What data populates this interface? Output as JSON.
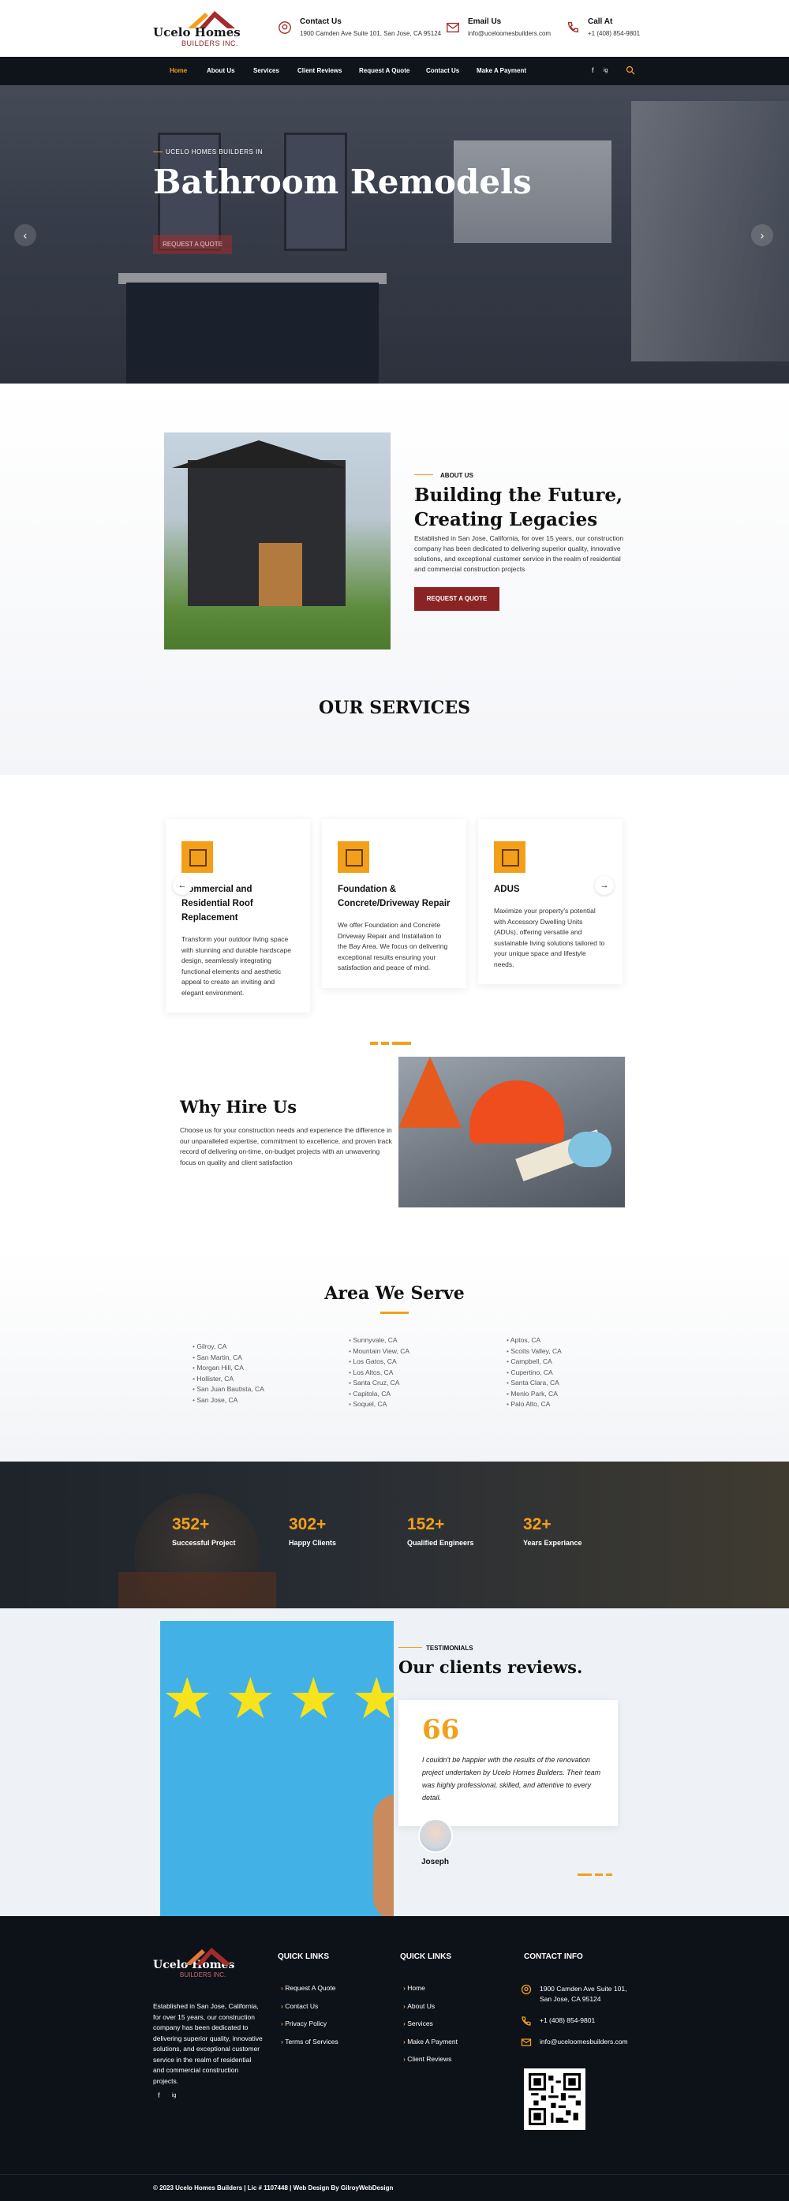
{
  "header": {
    "logo_name": "Ucelo Homes",
    "logo_sub": "BUILDERS INC.",
    "contact_us_title": "Contact Us",
    "contact_us_value": "1900 Camden Ave Suite 101, San Jose, CA 95124",
    "email_title": "Email Us",
    "email_value": "info@uceloomesbuilders.com",
    "call_title": "Call At",
    "call_value": "+1 (408) 854-9801"
  },
  "nav": {
    "items": [
      "Home",
      "About Us",
      "Services",
      "Client Reviews",
      "Request A Quote",
      "Contact Us",
      "Make A Payment"
    ],
    "social": [
      "f",
      "ig"
    ],
    "search_icon": "search-icon"
  },
  "hero": {
    "eyebrow": "UCELO HOMES BUILDERS IN",
    "title": "Bathroom Remodels",
    "cta": "REQUEST A QUOTE",
    "prev": "‹",
    "next": "›"
  },
  "about": {
    "label": "ABOUT US",
    "title": "Building the Future, Creating Legacies",
    "text": "Established in San Jose, California, for over 15 years, our construction company has been dedicated to delivering superior quality, innovative solutions, and exceptional customer service in the realm of residential and commercial construction projects",
    "button": "REQUEST A QUOTE",
    "services_heading": "OUR SERVICES"
  },
  "services": {
    "cards": [
      {
        "title": "Commercial and Residential Roof Replacement",
        "text": "Transform your outdoor living space with stunning and durable hardscape design, seamlessly integrating functional elements and aesthetic appeal to create an inviting and elegant environment."
      },
      {
        "title": "Foundation & Concrete/Driveway Repair",
        "text": "We offer Foundation and Concrete Driveway Repair and Installation to the Bay Area. We focus on delivering exceptional results ensuring your satisfaction and peace of mind."
      },
      {
        "title": "ADUS",
        "text": "Maximize your property's potential with Accessory Dwelling Units (ADUs), offering versatile and sustainable living solutions tailored to your unique space and lifestyle needs."
      }
    ],
    "prev": "←",
    "next": "→"
  },
  "why": {
    "title": "Why Hire Us",
    "text": "Choose us for your construction needs and experience the difference in our unparalleled expertise, commitment to excellence, and proven track record of delivering on-time, on-budget projects with an unwavering focus on quality and client satisfaction"
  },
  "area": {
    "title": "Area We Serve",
    "col1": [
      "Gilroy, CA",
      "San Martin, CA",
      "Morgan Hill, CA",
      "Hollister, CA",
      "San Juan Bautista, CA",
      "San Jose, CA"
    ],
    "col2": [
      "Sunnyvale, CA",
      "Mountain View, CA",
      "Los Gatos, CA",
      "Los Altos, CA",
      "Santa Cruz, CA",
      "Capitola, CA",
      "Soquel, CA"
    ],
    "col3": [
      "Aptos, CA",
      "Scotts Valley, CA",
      "Campbell, CA",
      "Cupertino, CA",
      "Santa Clara, CA",
      "Menlo Park, CA",
      "Palo Alto, CA"
    ]
  },
  "stats": [
    {
      "num": "352+",
      "label": "Successful Project"
    },
    {
      "num": "302+",
      "label": "Happy Clients"
    },
    {
      "num": "152+",
      "label": "Qualified Engineers"
    },
    {
      "num": "32+",
      "label": "Years Experiance"
    }
  ],
  "testimonials": {
    "label": "TESTIMONIALS",
    "title": "Our clients reviews.",
    "quote_mark": "66",
    "quote": "I couldn't be happier with the results of the renovation project undertaken by Ucelo Homes Builders. Their team was highly professional, skilled, and attentive to every detail.",
    "author": "Joseph"
  },
  "footer": {
    "logo_name": "Ucelo Homes",
    "logo_sub": "BUILDERS INC.",
    "about": "Established in San Jose, California, for over 15 years, our construction company has been dedicated to delivering superior quality, innovative solutions, and exceptional customer service in the realm of residential and commercial construction projects.",
    "social": [
      "f",
      "ig"
    ],
    "col1_title": "QUICK LINKS",
    "col1_links": [
      "Request A Quote",
      "Contact Us",
      "Privacy Policy",
      "Terms of Services"
    ],
    "col2_title": "QUICK LINKS",
    "col2_links": [
      "Home",
      "About Us",
      "Services",
      "Make A Payment",
      "Client Reviews"
    ],
    "contact_title": "CONTACT INFO",
    "address": "1900 Camden Ave Suite 101, San Jose, CA 95124",
    "phone": "+1 (408) 854-9801",
    "email": "info@uceloomesbuilders.com",
    "copyright": "© 2023 Ucelo Homes Builders | Lic # 1107448 | Web Design By GilroyWebDesign"
  },
  "colors": {
    "accent": "#f2a01a",
    "brand": "#8a2323",
    "dark": "#0f141b"
  }
}
